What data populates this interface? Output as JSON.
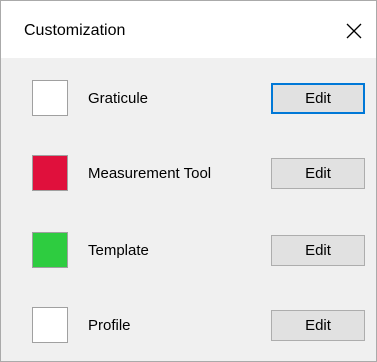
{
  "dialog": {
    "title": "Customization"
  },
  "close_glyph": "✕",
  "items": [
    {
      "label": "Graticule",
      "color": "#ffffff",
      "button": "Edit",
      "focused": true
    },
    {
      "label": "Measurement Tool",
      "color": "#e0103c",
      "button": "Edit",
      "focused": false
    },
    {
      "label": "Template",
      "color": "#2ecc40",
      "button": "Edit",
      "focused": false
    },
    {
      "label": "Profile",
      "color": "#ffffff",
      "button": "Edit",
      "focused": false
    }
  ]
}
